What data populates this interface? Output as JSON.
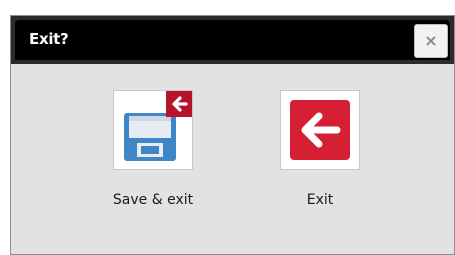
{
  "dialog": {
    "title": "Exit?",
    "close_glyph": "×",
    "close_icon": "close-icon",
    "actions": [
      {
        "label": "Save & exit",
        "icon": "save-and-exit-icon"
      },
      {
        "label": "Exit",
        "icon": "exit-arrow-icon"
      }
    ]
  },
  "colors": {
    "title_bar": "#000000",
    "dialog_background": "#e2e2e2",
    "save_disk": "#3f86c6",
    "exit_red": "#d42032",
    "badge_red": "#b5152a"
  }
}
